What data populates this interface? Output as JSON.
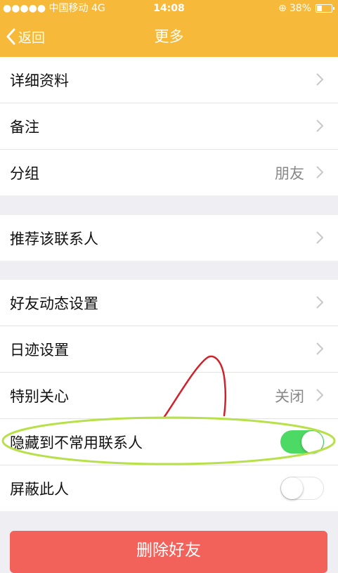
{
  "status": {
    "carrier": "●●●●● 中国移动  4G",
    "time": "14:08",
    "battery": "38%",
    "battery_level": 0.38
  },
  "nav": {
    "back_label": "返回",
    "title": "更多"
  },
  "groups": [
    {
      "rows": [
        {
          "label": "详细资料",
          "value": "",
          "accessory": "chevron"
        },
        {
          "label": "备注",
          "value": "",
          "accessory": "chevron"
        },
        {
          "label": "分组",
          "value": "朋友",
          "accessory": "chevron"
        }
      ]
    },
    {
      "rows": [
        {
          "label": "推荐该联系人",
          "value": "",
          "accessory": "chevron"
        }
      ]
    },
    {
      "rows": [
        {
          "label": "好友动态设置",
          "value": "",
          "accessory": "chevron"
        },
        {
          "label": "日迹设置",
          "value": "",
          "accessory": "chevron"
        },
        {
          "label": "特别关心",
          "value": "关闭",
          "accessory": "chevron"
        },
        {
          "label": "隐藏到不常用联系人",
          "accessory": "toggle",
          "toggle_on": true
        },
        {
          "label": "屏蔽此人",
          "accessory": "toggle",
          "toggle_on": false
        }
      ]
    }
  ],
  "delete_button": "删除好友",
  "colors": {
    "nav_bar": "#f6b93a",
    "toggle_on": "#4cd964",
    "delete_button": "#f2615a",
    "annotation_red": "#d0222a",
    "annotation_green": "#b8e04a"
  }
}
